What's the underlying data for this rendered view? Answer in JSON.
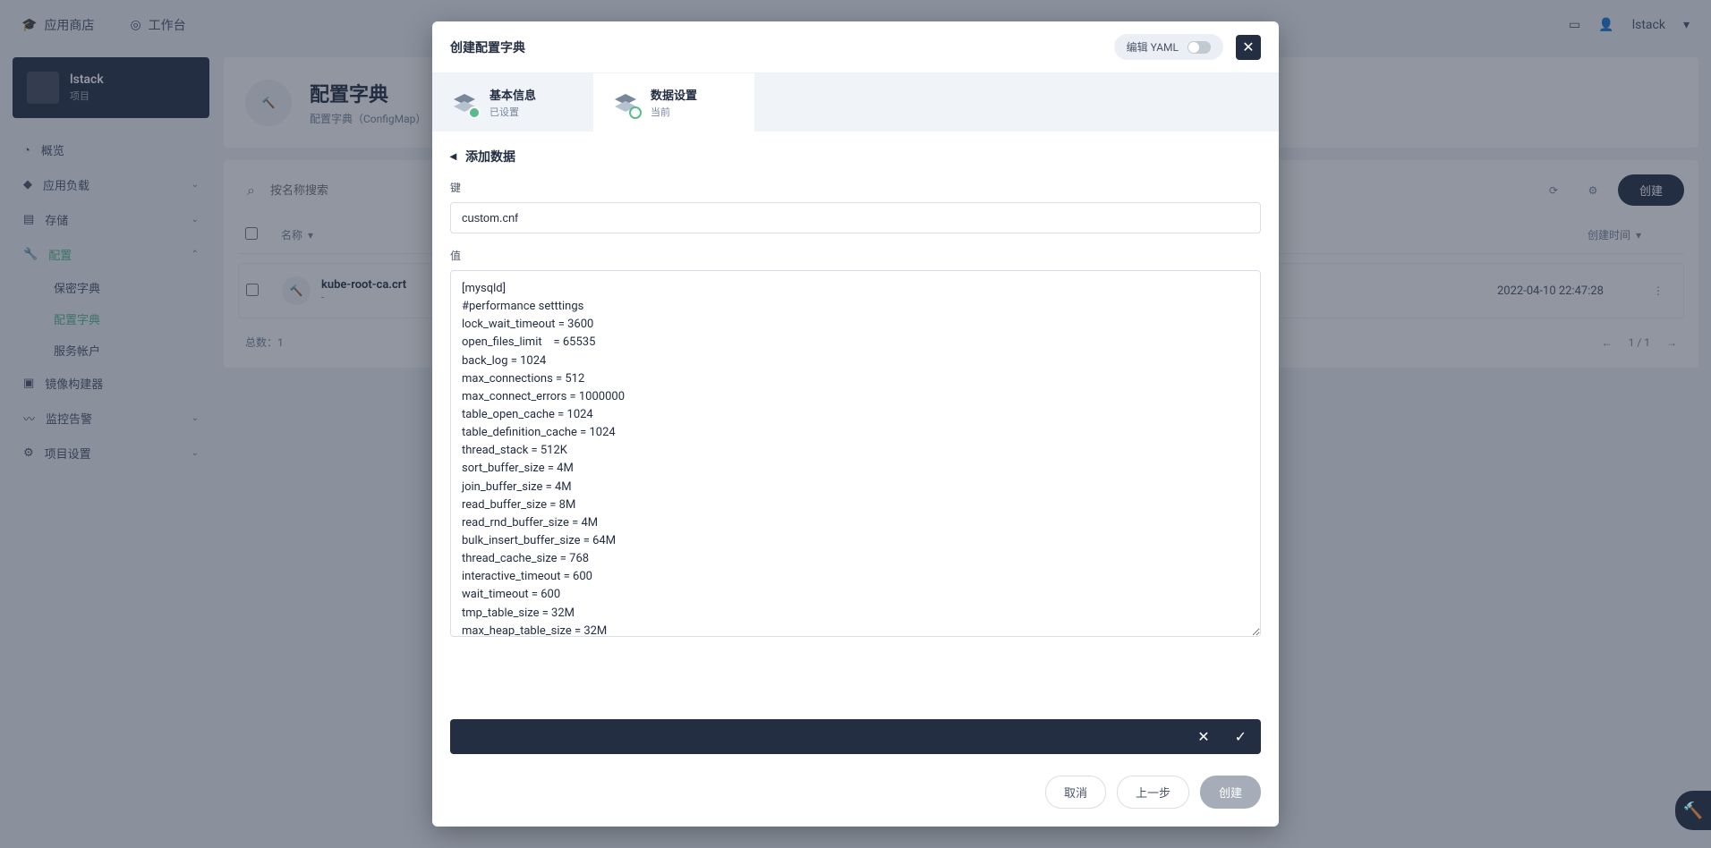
{
  "nav": {
    "app_store": "应用商店",
    "workbench": "工作台",
    "user": "lstack"
  },
  "project": {
    "name": "lstack",
    "sub": "项目"
  },
  "sidebar": {
    "overview": "概览",
    "workloads": "应用负载",
    "storage": "存储",
    "config": "配置",
    "secrets": "保密字典",
    "configmaps": "配置字典",
    "service_accounts": "服务帐户",
    "image_builder": "镜像构建器",
    "monitoring": "监控告警",
    "project_settings": "项目设置"
  },
  "page": {
    "title": "配置字典",
    "subtitle": "配置字典（ConfigMap）"
  },
  "search": {
    "placeholder": "按名称搜索"
  },
  "create_btn": "创建",
  "table": {
    "name_header": "名称",
    "time_header": "创建时间",
    "row": {
      "name": "kube-root-ca.crt",
      "sub": "-",
      "time": "2022-04-10 22:47:28"
    }
  },
  "pagination": {
    "total": "总数：1",
    "page": "1 / 1"
  },
  "modal": {
    "title": "创建配置字典",
    "yaml_label": "编辑 YAML",
    "step1": {
      "label": "基本信息",
      "sub": "已设置"
    },
    "step2": {
      "label": "数据设置",
      "sub": "当前"
    },
    "add_data": "添加数据",
    "key_label": "键",
    "key_value": "custom.cnf",
    "value_label": "值",
    "value_text": "[mysqld]\n#performance setttings\nlock_wait_timeout = 3600\nopen_files_limit    = 65535\nback_log = 1024\nmax_connections = 512\nmax_connect_errors = 1000000\ntable_open_cache = 1024\ntable_definition_cache = 1024\nthread_stack = 512K\nsort_buffer_size = 4M\njoin_buffer_size = 4M\nread_buffer_size = 8M\nread_rnd_buffer_size = 4M\nbulk_insert_buffer_size = 64M\nthread_cache_size = 768\ninteractive_timeout = 600\nwait_timeout = 600\ntmp_table_size = 32M\nmax_heap_table_size = 32M",
    "cancel": "取消",
    "prev": "上一步",
    "create": "创建"
  }
}
